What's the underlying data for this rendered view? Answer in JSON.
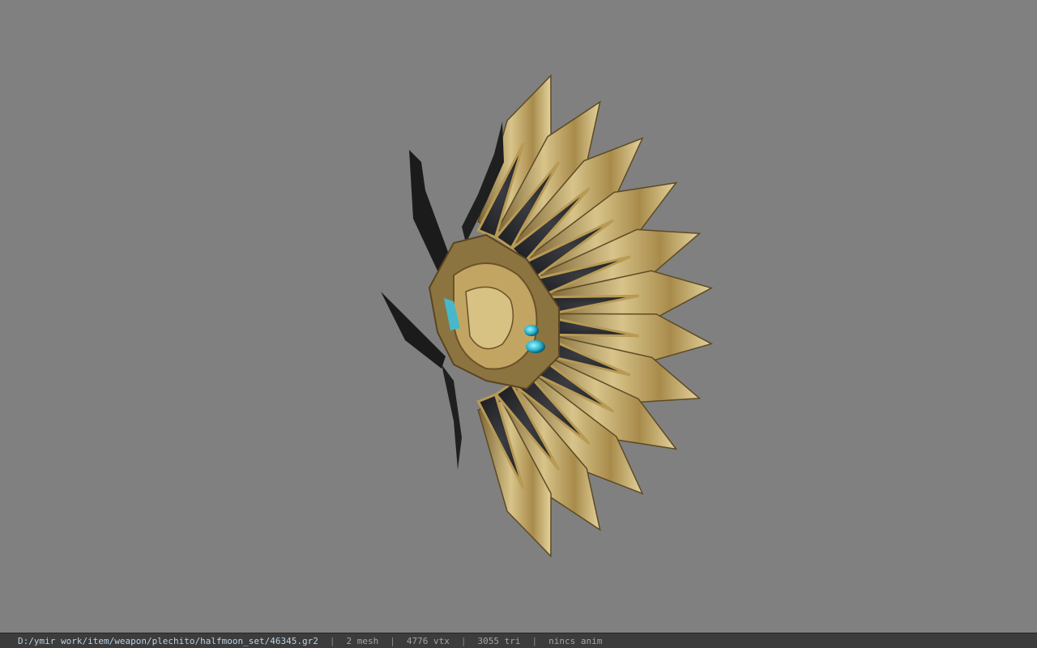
{
  "viewer": {
    "background_color": "#808080",
    "model": {
      "icon": "ornate-fan-weapon-model",
      "gold_color": "#b69a5a",
      "dark_color": "#2c2d30",
      "gem_color": "#2fb7d3"
    }
  },
  "status_bar": {
    "file_path": "D:/ymir work/item/weapon/plechito/halfmoon_set/46345.gr2",
    "separator": "|",
    "mesh_count": "2 mesh",
    "vertex_count": "4776 vtx",
    "triangle_count": "3055 tri",
    "animation": "nincs anim"
  }
}
